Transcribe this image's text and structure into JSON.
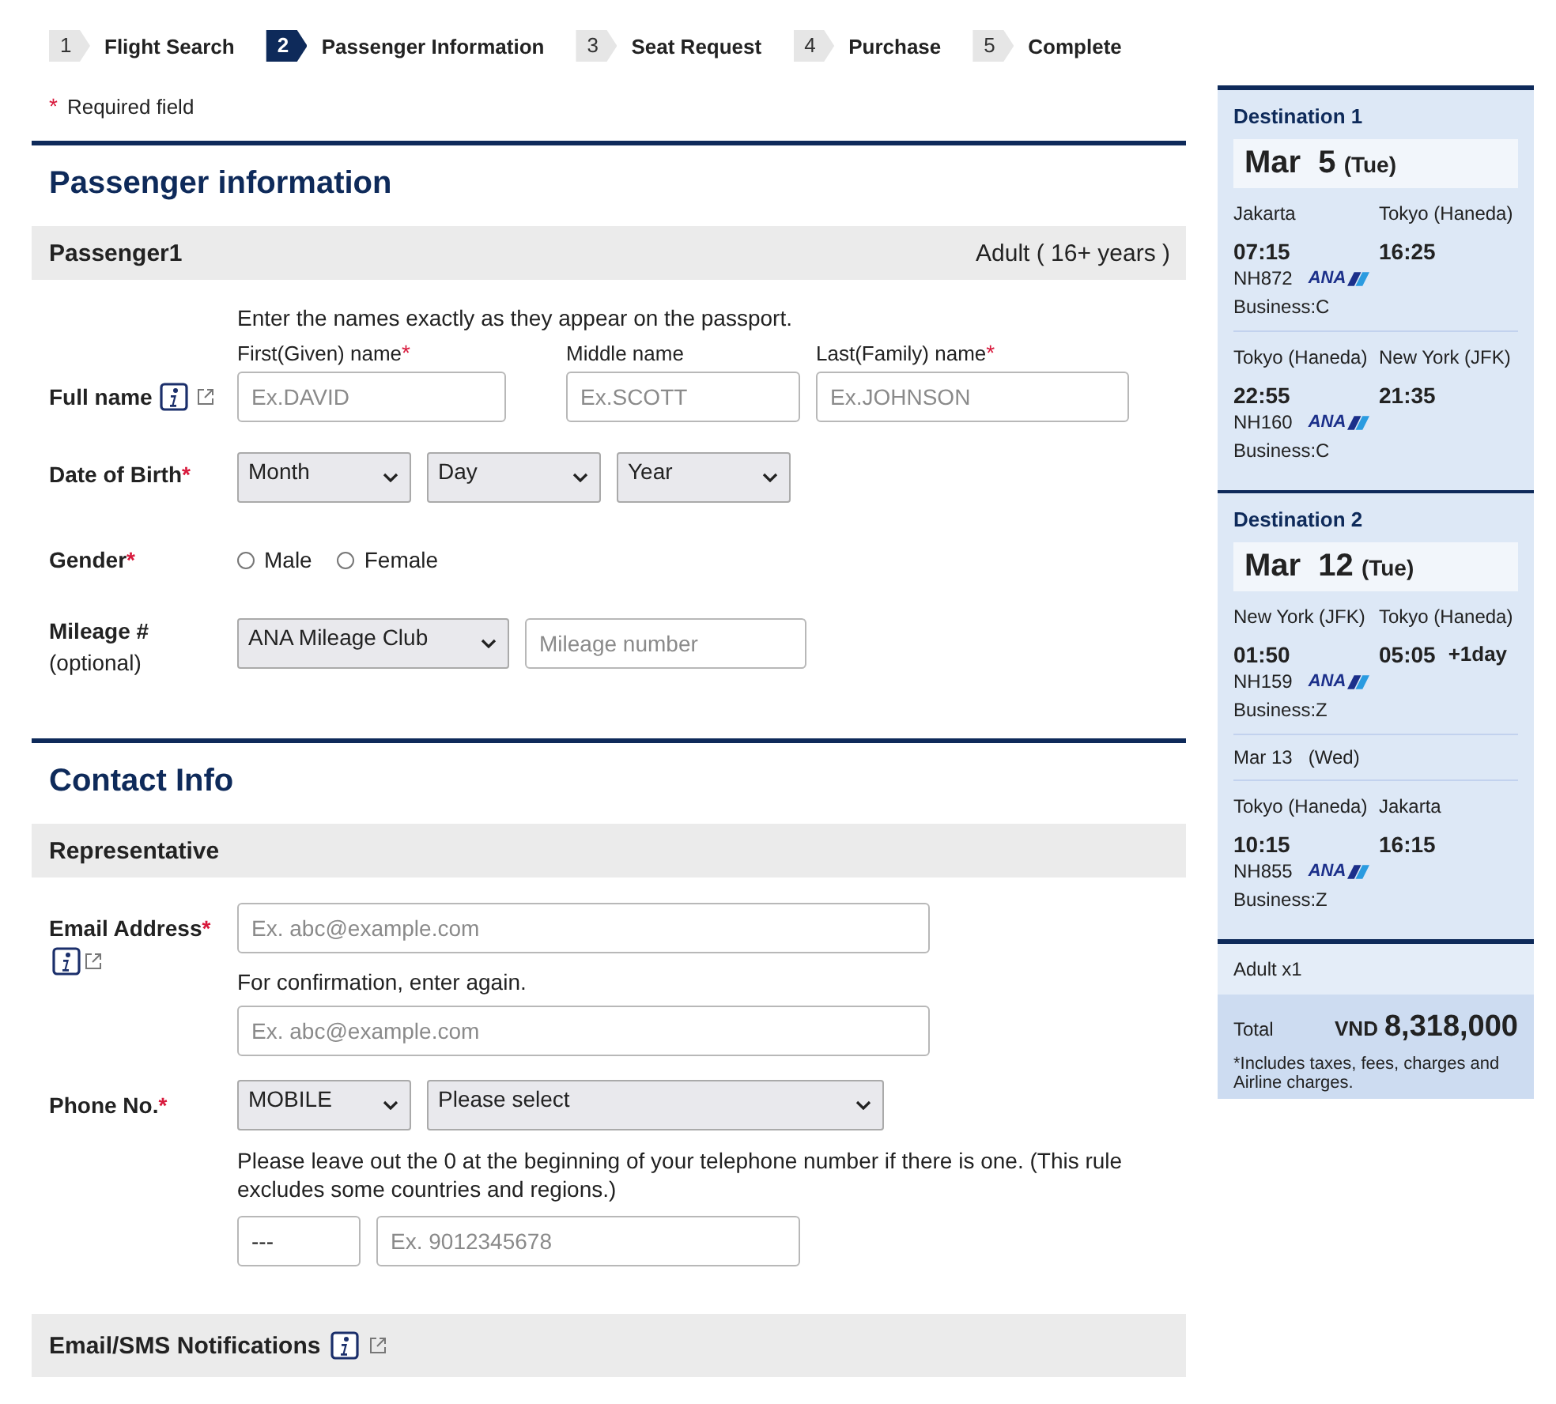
{
  "required_mark": "*",
  "steps": [
    {
      "number": "1",
      "label": "Flight Search",
      "selected": false
    },
    {
      "number": "2",
      "label": "Passenger Information",
      "selected": true
    },
    {
      "number": "3",
      "label": "Seat Request",
      "selected": false
    },
    {
      "number": "4",
      "label": "Purchase",
      "selected": false
    },
    {
      "number": "5",
      "label": "Complete",
      "selected": false
    }
  ],
  "required_note": "Required field",
  "passenger_section": {
    "title": "Passenger information",
    "passenger_name": "Passenger1",
    "passenger_type": "Adult ( 16+ years )",
    "name_hint": "Enter the names exactly as they appear on the passport.",
    "full_name": {
      "label": "Full name",
      "required": false,
      "parts": [
        {
          "label": "First(Given) name",
          "required": true,
          "placeholder": "Ex.DAVID"
        },
        {
          "label": "Middle name",
          "required": false,
          "placeholder": "Ex.SCOTT"
        },
        {
          "label": "Last(Family) name",
          "required": true,
          "placeholder": "Ex.JOHNSON"
        }
      ]
    },
    "date_of_birth": {
      "label": "Date of Birth",
      "required": true,
      "selects": [
        "Month",
        "Day",
        "Year"
      ]
    },
    "gender": {
      "label": "Gender",
      "required": true,
      "options": [
        {
          "label": "Male",
          "selected": false
        },
        {
          "label": "Female",
          "selected": false
        }
      ]
    },
    "mileage": {
      "label": "Mileage #",
      "sublabel": "(optional)",
      "program": "ANA Mileage Club",
      "placeholder": "Mileage number"
    }
  },
  "contact_section": {
    "title": "Contact Info",
    "subheading": "Representative",
    "email": {
      "label": "Email Address",
      "required": true,
      "placeholder": "Ex. abc@example.com",
      "confirm_hint": "For confirmation, enter again.",
      "confirm_placeholder": "Ex. abc@example.com"
    },
    "phone": {
      "label": "Phone No.",
      "required": true,
      "type": "MOBILE",
      "country": "Please select",
      "note": "Please leave out the 0 at the beginning of your telephone number if there is one. (This rule excludes some countries and regions.)",
      "area_code": "---",
      "placeholder": "Ex. 9012345678"
    },
    "notifications": {
      "label": "Email/SMS Notifications"
    }
  },
  "itinerary": {
    "destinations": [
      {
        "title": "Destination 1",
        "month": "Mar",
        "day": "5",
        "weekday": "(Tue)",
        "segments": [
          {
            "from": "Jakarta",
            "to": "Tokyo (Haneda)",
            "depart": "07:15",
            "arrive": "16:25",
            "flight": "NH872",
            "airline": "ANA",
            "cabin": "Business:C"
          },
          {
            "from": "Tokyo (Haneda)",
            "to": "New York (JFK)",
            "depart": "22:55",
            "arrive": "21:35",
            "flight": "NH160",
            "airline": "ANA",
            "cabin": "Business:C"
          }
        ]
      },
      {
        "title": "Destination 2",
        "month": "Mar",
        "day": "12",
        "weekday": "(Tue)",
        "segments": [
          {
            "from": "New York (JFK)",
            "to": "Tokyo (Haneda)",
            "depart": "01:50",
            "arrive": "05:05",
            "arrive_note": "+1day",
            "flight": "NH159",
            "airline": "ANA",
            "cabin": "Business:Z"
          },
          {
            "date": "Mar 13",
            "date_weekday": "(Wed)",
            "from": "Tokyo (Haneda)",
            "to": "Jakarta",
            "depart": "10:15",
            "arrive": "16:15",
            "flight": "NH855",
            "airline": "ANA",
            "cabin": "Business:Z"
          }
        ]
      }
    ],
    "travelers": "Adult x1",
    "total_label": "Total",
    "currency": "VND",
    "amount": "8,318,000",
    "footnote": "*Includes taxes, fees, charges and Airline charges."
  }
}
